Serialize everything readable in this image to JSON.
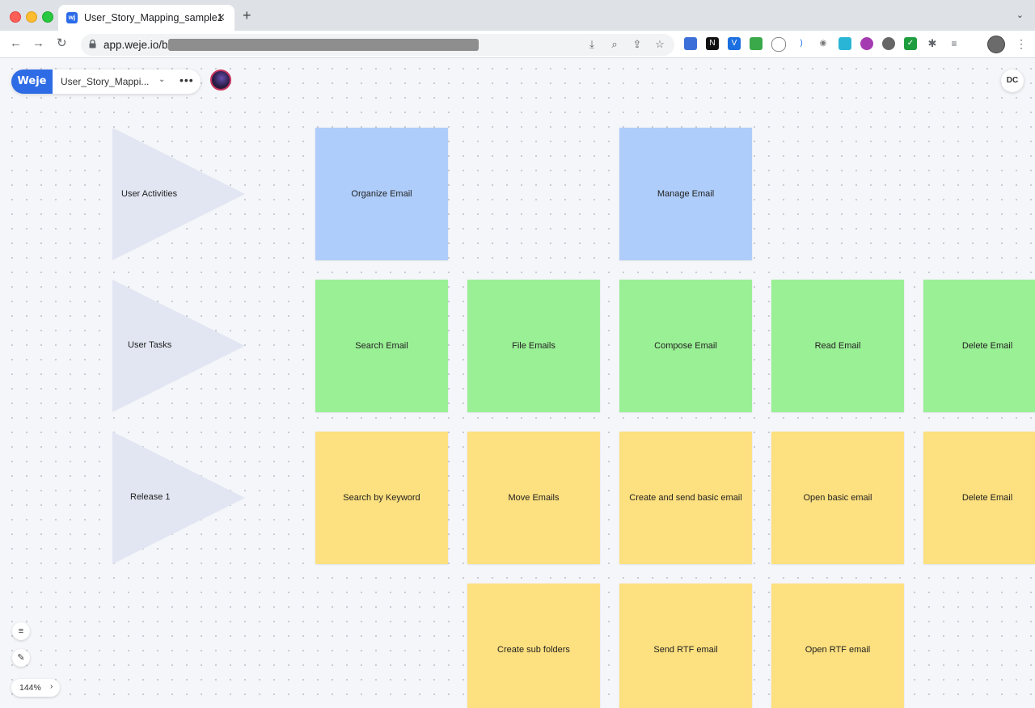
{
  "browser": {
    "tab_title": "User_Story_Mapping_sample1",
    "favicon_text": "wj",
    "tab_close": "✕",
    "new_tab": "+",
    "url": "app.weje.io/b/"
  },
  "board": {
    "logo": "Weje",
    "name": "User_Story_Mappi...",
    "more": "•••",
    "user_initials": "DC",
    "zoom": "144%"
  },
  "rows": [
    {
      "label": "User Activities"
    },
    {
      "label": "User Tasks"
    },
    {
      "label": "Release 1"
    }
  ],
  "activities": [
    "Organize Email",
    "Manage Email"
  ],
  "tasks": [
    "Search Email",
    "File Emails",
    "Compose Email",
    "Read Email",
    "Delete Email"
  ],
  "release1": [
    "Search by Keyword",
    "Move Emails",
    "Create and send basic email",
    "Open basic email",
    "Delete Email"
  ],
  "release1_row2": [
    "Create sub folders",
    "Send RTF email",
    "Open RTF email"
  ],
  "colors": {
    "activity": "#aecdfa",
    "task": "#9af095",
    "release": "#fde07f",
    "brand": "#2e6ce6"
  }
}
